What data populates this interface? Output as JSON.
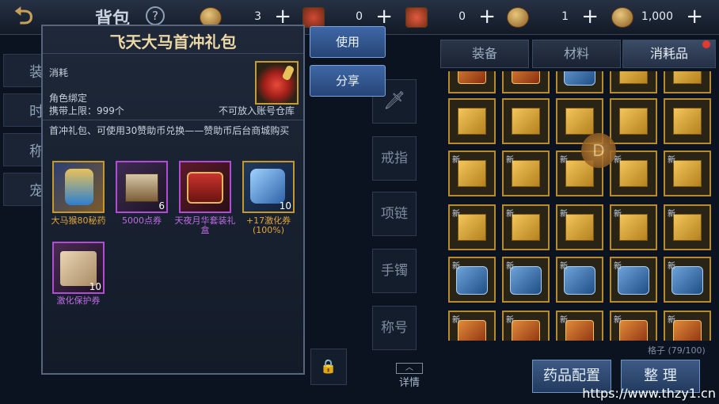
{
  "header": {
    "title": "背包",
    "help_label": "?",
    "currencies": [
      {
        "icon": "gold-coin-icon",
        "value": "3"
      },
      {
        "icon": "scroll-ticket-icon",
        "value": "0"
      },
      {
        "icon": "map-ticket-icon",
        "value": "0"
      },
      {
        "icon": "token-icon",
        "value": "1"
      },
      {
        "icon": "gold-ingot-icon",
        "value": "1,000"
      }
    ],
    "plus_label": "+"
  },
  "left_tabs": [
    "装",
    "时",
    "称",
    "宠"
  ],
  "inventory": {
    "tabs": [
      "装备",
      "材料",
      "消耗品"
    ],
    "active_tab": "消耗品",
    "new_badge": "新",
    "capacity": "格子 (79/100)",
    "buttons": {
      "potion_config": "药品配置",
      "sort": "整 理"
    },
    "overlay_letter": "D"
  },
  "equip_slots": [
    "戒指",
    "项链",
    "手镯",
    "称号"
  ],
  "detail_label": "详情",
  "popup": {
    "title": "飞天大马首冲礼包",
    "category": "消耗",
    "binding": "角色绑定",
    "carry_limit": "携带上限：999个",
    "account_storage": "不可放入账号仓库",
    "description": "首冲礼包、可使用30赞助币兑换——赞助币后台商城购买",
    "rewards": [
      {
        "name": "大马猴80秘药",
        "count": "",
        "rarity": "gold"
      },
      {
        "name": "5000点券",
        "count": "6",
        "rarity": "purple"
      },
      {
        "name": "天夜月华套装礼盒",
        "count": "",
        "rarity": "purple"
      },
      {
        "name": "+17激化券(100%)",
        "count": "10",
        "rarity": "gold"
      },
      {
        "name": "激化保护券",
        "count": "10",
        "rarity": "purple"
      }
    ],
    "use_button": "使用",
    "share_button": "分享"
  },
  "watermark": "https://www.thzy1.cn"
}
